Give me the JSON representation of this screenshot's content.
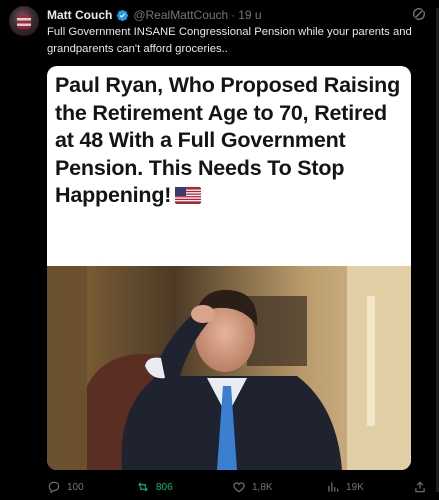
{
  "author": {
    "name": "Matt Couch",
    "handle": "@RealMattCouch",
    "separator": "·",
    "time": "19 u"
  },
  "tweet": {
    "text": "Full Government INSANE Congressional Pension while your parents and grandparents can't afford groceries.."
  },
  "card": {
    "headline": "Paul Ryan, Who Proposed Raising the Retirement Age to 70, Retired at 48 With a Full Government Pension. This Needs To Stop Happening!",
    "flag_icon": "us-flag-emoji"
  },
  "actions": {
    "replies": "100",
    "retweets": "806",
    "likes": "1,8K",
    "views": "19K"
  },
  "colors": {
    "background": "#000000",
    "text": "#e7e9ea",
    "muted": "#71767b",
    "retweet": "#00ba7c",
    "verified": "#1d9bf0"
  }
}
